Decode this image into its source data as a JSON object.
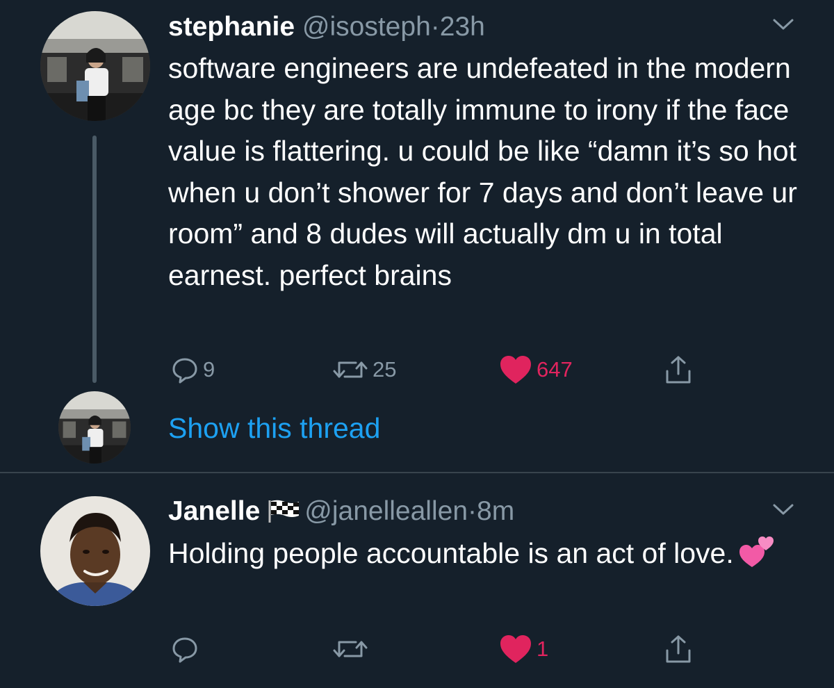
{
  "tweets": [
    {
      "display_name": "stephanie",
      "handle": "@isosteph",
      "separator": "·",
      "time": "23h",
      "text": "software engineers are undefeated in the modern age bc they are totally immune to irony if the face value is flattering. u could be like “damn it’s so hot when u don’t shower for 7 days and don’t leave ur room” and 8 dudes will actually dm u in total earnest. perfect brains",
      "reply_count": "9",
      "retweet_count": "25",
      "like_count": "647",
      "liked": true,
      "show_thread_label": "Show this thread",
      "avatar_icon": "user-photo-avatar"
    },
    {
      "display_name": "Janelle",
      "name_emoji": "chequered-flag-icon",
      "handle": "@janelleallen",
      "separator": "·",
      "time": "8m",
      "text": "Holding people accountable is an act of love.",
      "text_emoji": "two-hearts-icon",
      "reply_count": "",
      "retweet_count": "",
      "like_count": "1",
      "liked": true,
      "avatar_icon": "user-photo-avatar"
    }
  ],
  "colors": {
    "background": "#15202b",
    "text": "#ffffff",
    "secondary": "#8899a6",
    "link": "#1da1f2",
    "like": "#e0245e",
    "divider": "#38444d"
  },
  "icons": {
    "reply": "reply-icon",
    "retweet": "retweet-icon",
    "like": "heart-icon",
    "share": "share-icon",
    "menu": "chevron-down-icon"
  }
}
